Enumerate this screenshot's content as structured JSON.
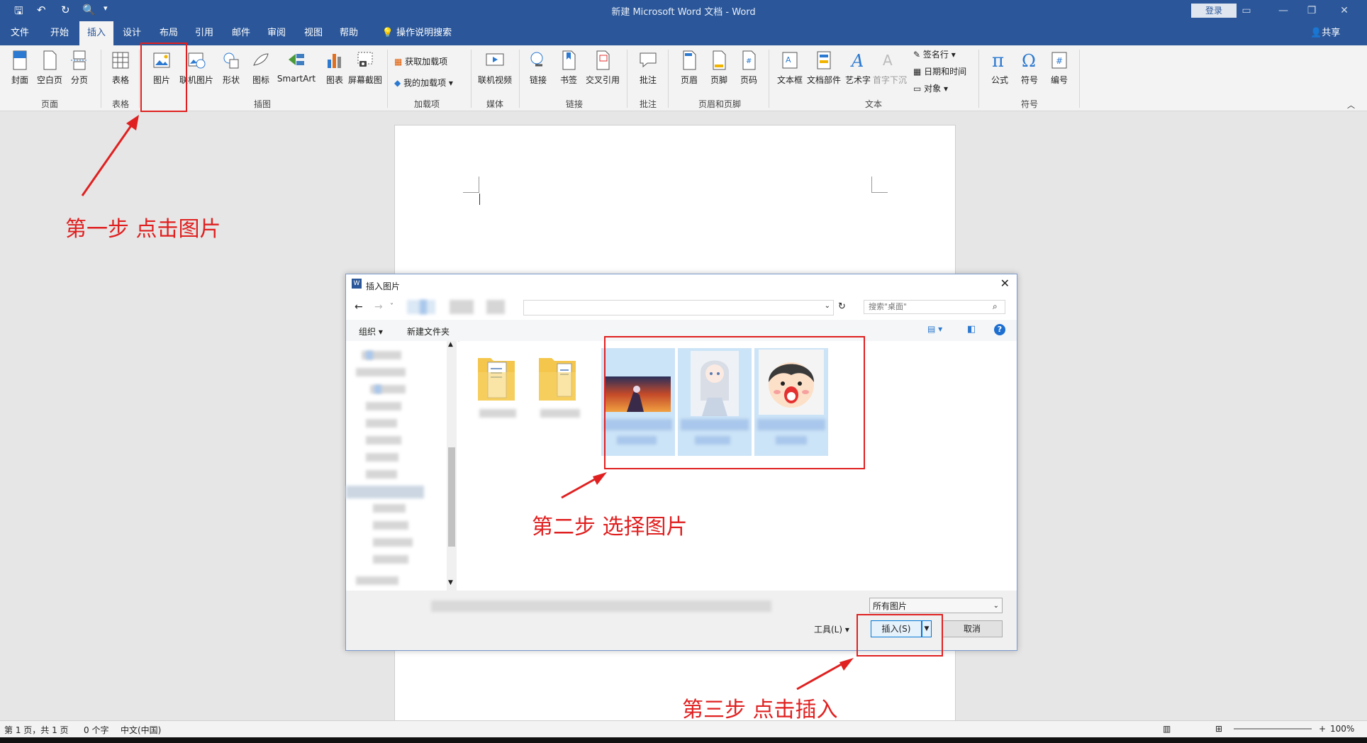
{
  "title_bar": {
    "title": "新建 Microsoft Word 文档 - Word",
    "sign_in": "登录"
  },
  "tabs": [
    "文件",
    "开始",
    "插入",
    "设计",
    "布局",
    "引用",
    "邮件",
    "审阅",
    "视图",
    "帮助"
  ],
  "tell_me": "操作说明搜索",
  "share": "共享",
  "ribbon": {
    "page_group": {
      "label": "页面",
      "items": [
        "封面",
        "空白页",
        "分页"
      ]
    },
    "table_group": {
      "label": "表格",
      "items": [
        "表格"
      ]
    },
    "illustrations_group": {
      "label": "插图",
      "items": [
        "图片",
        "联机图片",
        "形状",
        "图标",
        "SmartArt",
        "图表",
        "屏幕截图"
      ]
    },
    "addins_group": {
      "label": "加载项",
      "items": [
        "获取加载项",
        "我的加载项"
      ]
    },
    "media_group": {
      "label": "媒体",
      "items": [
        "联机视频"
      ]
    },
    "links_group": {
      "label": "链接",
      "items": [
        "链接",
        "书签",
        "交叉引用"
      ]
    },
    "comments_group": {
      "label": "批注",
      "items": [
        "批注"
      ]
    },
    "header_footer_group": {
      "label": "页眉和页脚",
      "items": [
        "页眉",
        "页脚",
        "页码"
      ]
    },
    "text_group": {
      "label": "文本",
      "items": [
        "文本框",
        "文档部件",
        "艺术字",
        "首字下沉"
      ],
      "small": [
        "签名行",
        "日期和时间",
        "对象"
      ]
    },
    "symbols_group": {
      "label": "符号",
      "items": [
        "公式",
        "符号",
        "编号"
      ]
    }
  },
  "dialog": {
    "title": "插入图片",
    "search_placeholder": "搜索\"桌面\"",
    "organize": "组织 ▾",
    "new_folder": "新建文件夹",
    "filter": "所有图片",
    "tools": "工具(L)",
    "insert": "插入(S)",
    "cancel": "取消"
  },
  "annotations": {
    "step1": "第一步  点击图片",
    "step2": "第二步 选择图片",
    "step3": "第三步 点击插入"
  },
  "status_bar": {
    "page": "第 1 页，共 1 页",
    "words": "0 个字",
    "language": "中文(中国)",
    "zoom": "100%"
  },
  "colors": {
    "word_blue": "#2b579a",
    "annotation_red": "#e02020",
    "selection_blue": "#cce4f7"
  }
}
